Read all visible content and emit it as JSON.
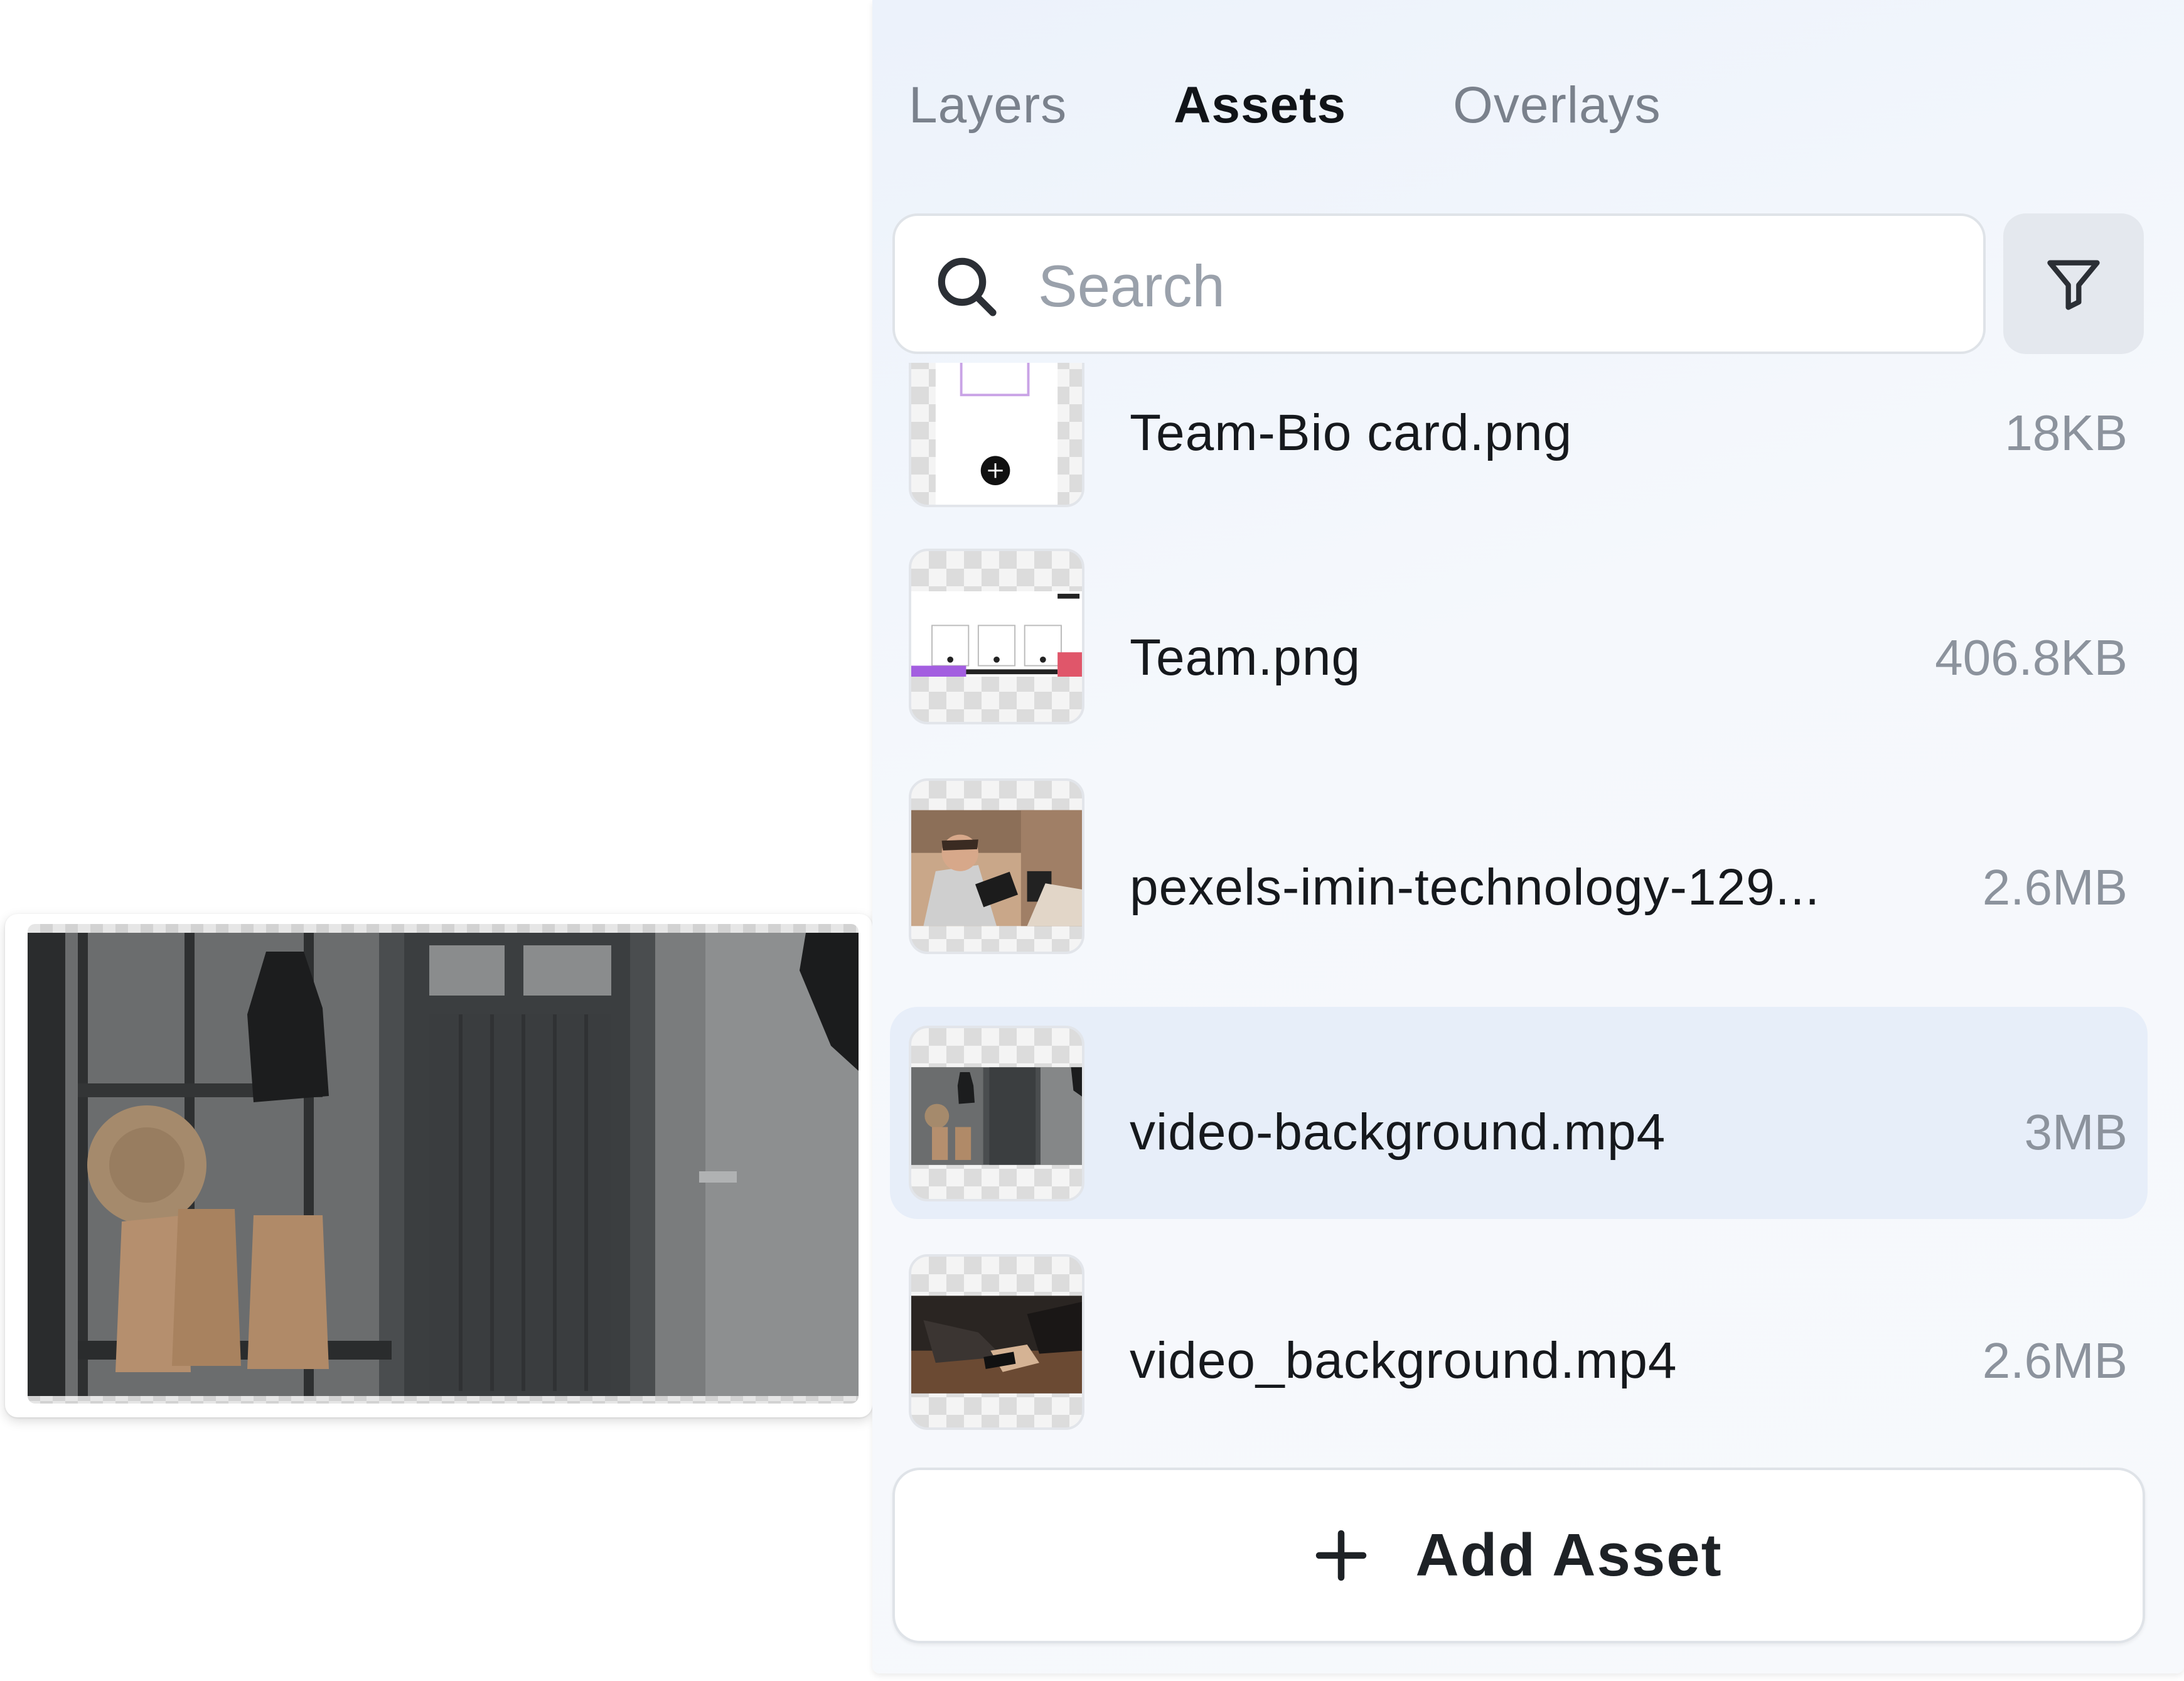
{
  "tabs": [
    {
      "label": "Layers",
      "active": false
    },
    {
      "label": "Assets",
      "active": true
    },
    {
      "label": "Overlays",
      "active": false
    }
  ],
  "search": {
    "placeholder": "Search",
    "value": "",
    "icon": "search-icon"
  },
  "filter": {
    "icon": "filter-icon"
  },
  "assets": [
    {
      "name": "Team-Bio card.png",
      "size": "18KB",
      "selected": false
    },
    {
      "name": "Team.png",
      "size": "406.8KB",
      "selected": false
    },
    {
      "name": "pexels-imin-technology-129...",
      "size": "2.6MB",
      "selected": false
    },
    {
      "name": "video-background.mp4",
      "size": "3MB",
      "selected": true
    },
    {
      "name": "video_background.mp4",
      "size": "2.6MB",
      "selected": false
    }
  ],
  "add_button": {
    "label": "Add Asset",
    "icon": "plus-icon"
  },
  "drag_preview": {
    "asset": "video-background.mp4"
  },
  "colors": {
    "selected_row": "#e7eef9",
    "panel_bg": "#f5f8fc",
    "text": "#16191d",
    "muted": "#8c939d"
  }
}
